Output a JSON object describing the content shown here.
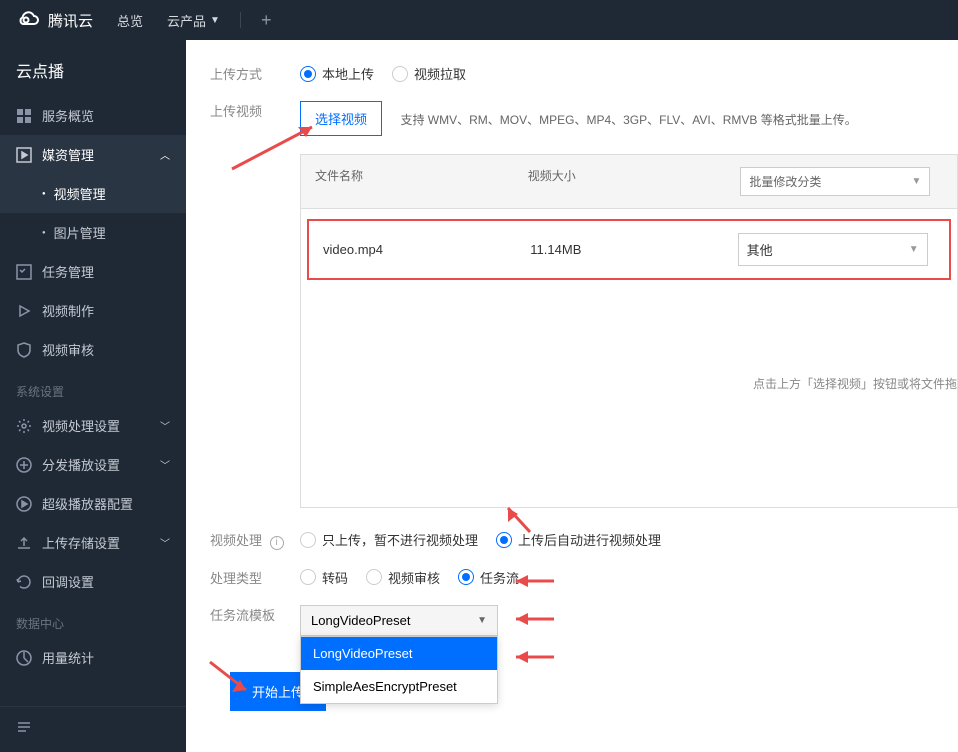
{
  "brand": "腾讯云",
  "topnav": {
    "overview": "总览",
    "products": "云产品"
  },
  "sidebar": {
    "title": "云点播",
    "items": {
      "service_overview": "服务概览",
      "media_mgmt": "媒资管理",
      "video_mgmt": "视频管理",
      "image_mgmt": "图片管理",
      "task_mgmt": "任务管理",
      "video_production": "视频制作",
      "video_audit": "视频审核"
    },
    "section_sys": "系统设置",
    "sys_items": {
      "video_process": "视频处理设置",
      "dist_play": "分发播放设置",
      "super_player": "超级播放器配置",
      "upload_storage": "上传存储设置",
      "callback": "回调设置"
    },
    "section_data": "数据中心",
    "data_items": {
      "usage_stats": "用量统计"
    }
  },
  "form": {
    "upload_method_label": "上传方式",
    "local_upload": "本地上传",
    "video_pull": "视频拉取",
    "upload_video_label": "上传视频",
    "select_video_btn": "选择视频",
    "format_hint": "支持 WMV、RM、MOV、MPEG、MP4、3GP、FLV、AVI、RMVB 等格式批量上传。",
    "table": {
      "col_filename": "文件名称",
      "col_size": "视频大小",
      "col_category": "批量修改分类",
      "row": {
        "filename": "video.mp4",
        "size": "11.14MB",
        "category": "其他"
      }
    },
    "empty_hint": "点击上方「选择视频」按钮或将文件拖",
    "video_process_label": "视频处理",
    "only_upload": "只上传，暂不进行视频处理",
    "auto_process": "上传后自动进行视频处理",
    "process_type_label": "处理类型",
    "transcode": "转码",
    "audit": "视频审核",
    "task_flow": "任务流",
    "task_template_label": "任务流模板",
    "template_selected": "LongVideoPreset",
    "template_options": {
      "opt1": "LongVideoPreset",
      "opt2": "SimpleAesEncryptPreset"
    },
    "start_upload": "开始上传"
  }
}
